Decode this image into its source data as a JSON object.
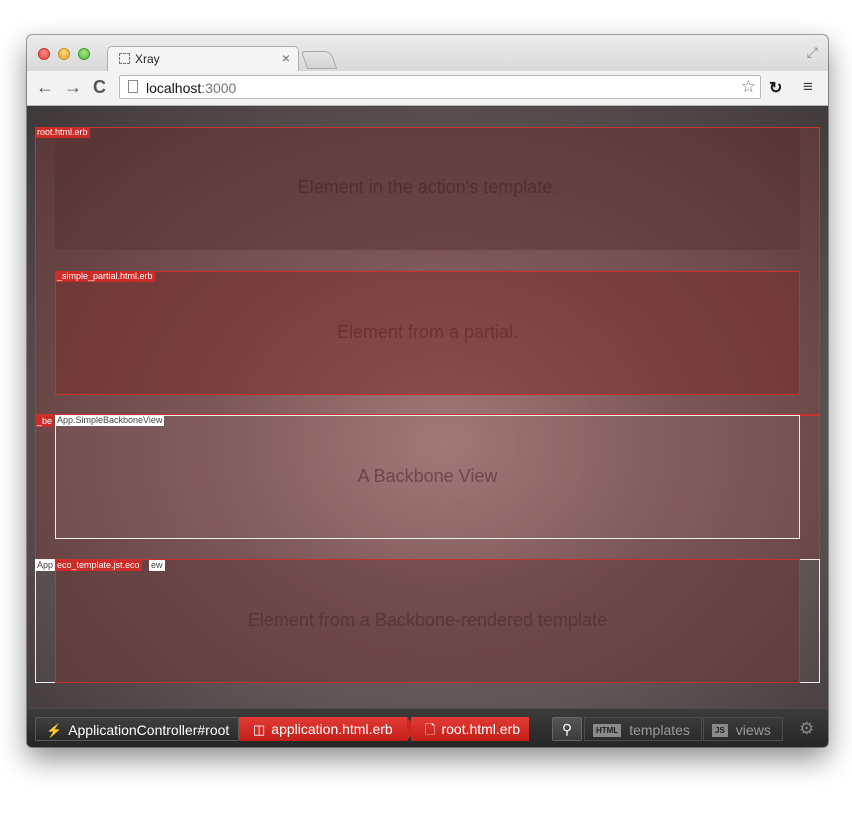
{
  "browser": {
    "tab_title": "Xray",
    "tab_close": "×",
    "url_host": "localhost",
    "url_port": ":3000",
    "nav_back": "←",
    "nav_forward": "→",
    "nav_reload": "C",
    "star": "☆",
    "menu": "≡",
    "fullscreen": "⤢"
  },
  "page": {
    "action_template_text": "Element in the action's template.",
    "partial_text": "Element from a partial.",
    "backbone_view_text": "A Backbone View",
    "backbone_template_text": "Element from a Backbone-rendered template"
  },
  "overlays": {
    "root_label": "root.html.erb",
    "partial_label": "_simple_partial.html.erb",
    "backbone_partial_label_fragment": "_be",
    "simple_backbone_view_label": "App.SimpleBackboneView",
    "app_view_label_left": "App",
    "eco_template_label": "eco_template.jst.eco",
    "app_view_label_right": "ew"
  },
  "xray_bar": {
    "controller": "ApplicationController#root",
    "layout": "application.html.erb",
    "template": "root.html.erb",
    "templates_badge": "HTML",
    "templates_label": "templates",
    "views_badge": "JS",
    "views_label": "views"
  },
  "colors": {
    "overlay_red": "#c8322d",
    "breadcrumb_red": "#d42e29"
  }
}
